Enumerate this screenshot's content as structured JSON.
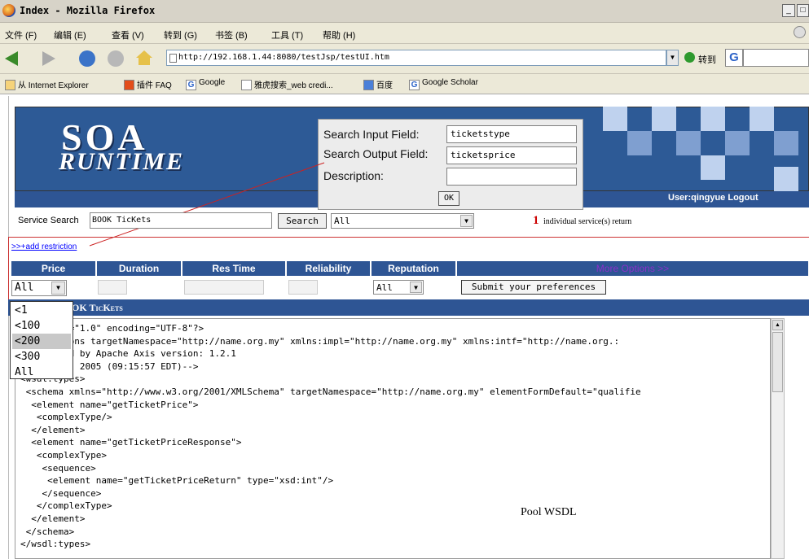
{
  "window": {
    "title": "Index - Mozilla Firefox"
  },
  "menu": [
    "文件 (F)",
    "编辑 (E)",
    "查看 (V)",
    "转到 (G)",
    "书签 (B)",
    "工具 (T)",
    "帮助 (H)"
  ],
  "nav": {
    "url": "http://192.168.1.44:8080/testJsp/testUI.htm",
    "go_label": "转到"
  },
  "bookmarks": [
    "从 Internet Explorer",
    "插件 FAQ",
    "Google",
    "雅虎搜索_web credi...",
    "百度",
    "Google Scholar"
  ],
  "header": {
    "logo_line1": "SOA",
    "logo_line2": "RUNTIME",
    "user_text": "User:qingyue Logout",
    "colors": {
      "header_blue": "#2d5a96",
      "bar_blue": "#2e5594"
    }
  },
  "popup": {
    "input_label": "Search Input Field:",
    "input_value": "ticketstype",
    "output_label": "Search Output Field:",
    "output_value": "ticketsprice",
    "desc_label": "Description:",
    "desc_value": "",
    "ok_label": "OK"
  },
  "search": {
    "label": "Service Search",
    "value": "BOOK TicKets",
    "button": "Search",
    "select": "All",
    "count": "1",
    "count_text": "individual service(s) return"
  },
  "restriction": {
    "link": ">>+add restriction",
    "headers": [
      "Price",
      "Duration",
      "Res Time",
      "Reliability",
      "Reputation"
    ],
    "more": "More Options >>",
    "price_value": "All",
    "reputation_value": "All",
    "submit": "Submit your preferences",
    "price_options": [
      "<1",
      "<100",
      "<200",
      "<300",
      "All"
    ],
    "highlighted_option": "<200"
  },
  "result": {
    "title": "OK TicKets"
  },
  "wsdl_lines": [
    "   ersion=\"1.0\" encoding=\"UTF-8\"?>",
    "   finitions targetNamespace=\"http://name.org.my\" xmlns:impl=\"http://name.org.my\" xmlns:intf=\"http://name.org.:",
    "   created by Apache Axis version: 1.2.1",
    "   Jun 14, 2005 (09:15:57 EDT)-->",
    "<wsdl:types>",
    " <schema xmlns=\"http://www.w3.org/2001/XMLSchema\" targetNamespace=\"http://name.org.my\" elementFormDefault=\"qualifie",
    "  <element name=\"getTicketPrice\">",
    "   <complexType/>",
    "  </element>",
    "  <element name=\"getTicketPriceResponse\">",
    "   <complexType>",
    "    <sequence>",
    "     <element name=\"getTicketPriceReturn\" type=\"xsd:int\"/>",
    "    </sequence>",
    "   </complexType>",
    "  </element>",
    " </schema>",
    "</wsdl:types>"
  ],
  "caption": "Pool WSDL"
}
